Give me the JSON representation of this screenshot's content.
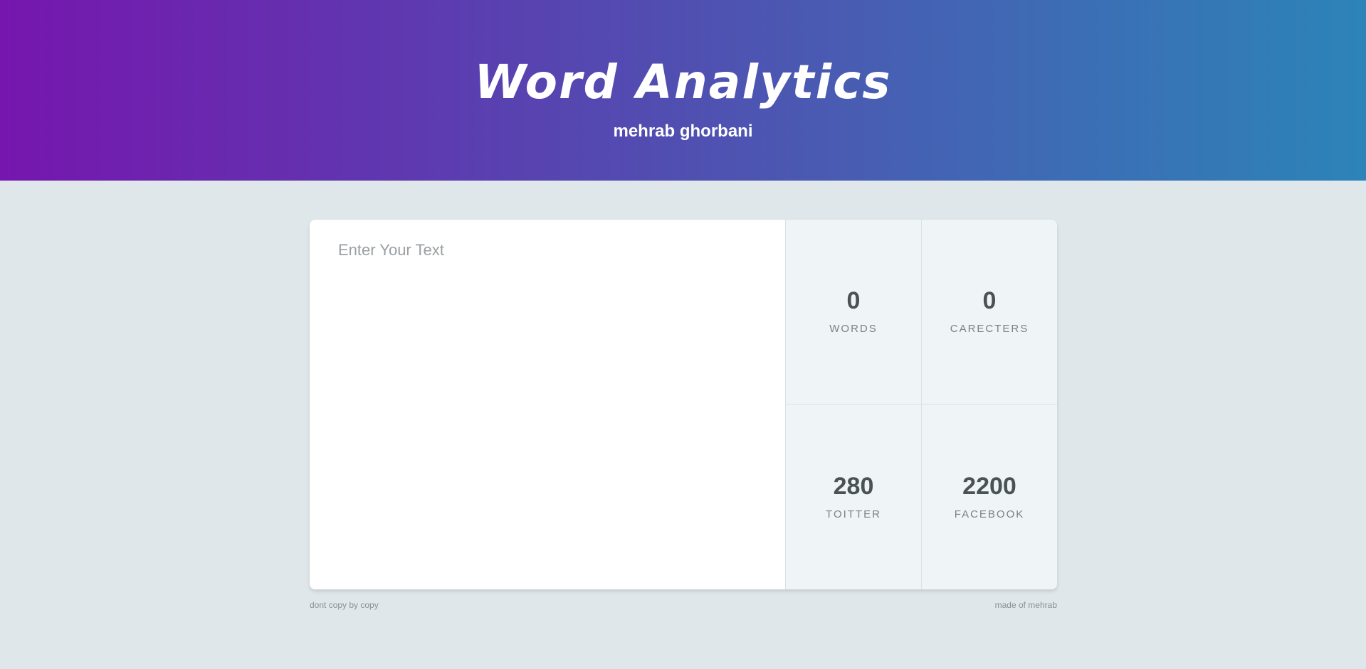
{
  "header": {
    "title": "Word Analytics",
    "subtitle": "mehrab ghorbani"
  },
  "editor": {
    "placeholder": "Enter Your Text",
    "value": ""
  },
  "stats": [
    {
      "value": "0",
      "label": "WORDS"
    },
    {
      "value": "0",
      "label": "CARECTERS"
    },
    {
      "value": "280",
      "label": "TOITTER"
    },
    {
      "value": "2200",
      "label": "FACEBOOK"
    }
  ],
  "footer": {
    "left": "dont copy by copy",
    "right": "made of mehrab"
  },
  "colors": {
    "gradient_start": "#7616ae",
    "gradient_end": "#2c84b8",
    "background": "#e0e7ea",
    "stat_panel": "#eff4f6"
  }
}
